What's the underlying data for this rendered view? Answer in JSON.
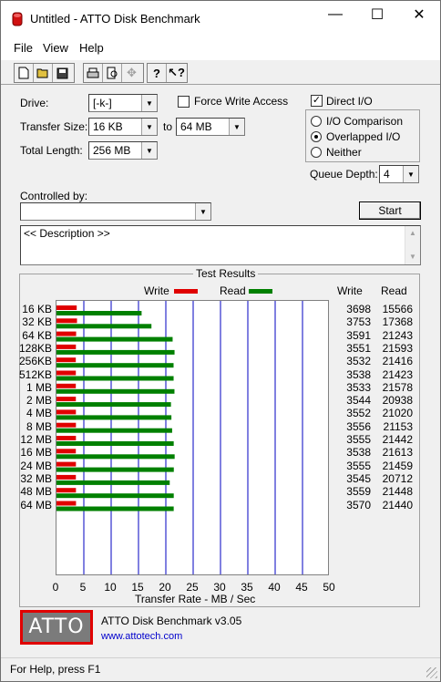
{
  "window": {
    "title": "Untitled - ATTO Disk Benchmark",
    "minimize_glyph": "—",
    "maximize_glyph": "☐",
    "close_glyph": "✕"
  },
  "menu": {
    "file": "File",
    "view": "View",
    "help": "Help"
  },
  "toolbar": {
    "buttons": [
      "new-icon",
      "open-icon",
      "save-icon",
      "print-icon",
      "print-preview-icon",
      "move-icon",
      "help-icon",
      "context-help-icon"
    ]
  },
  "settings": {
    "drive_label": "Drive:",
    "drive_value": "[-k-]",
    "force_write_label": "Force Write Access",
    "force_write_checked": false,
    "direct_io_label": "Direct I/O",
    "direct_io_checked": true,
    "transfer_size_label": "Transfer Size:",
    "transfer_from": "16 KB",
    "transfer_to_label": "to",
    "transfer_to": "64 MB",
    "total_length_label": "Total Length:",
    "total_length": "256 MB",
    "io_options": [
      "I/O Comparison",
      "Overlapped I/O",
      "Neither"
    ],
    "io_selected": "Overlapped I/O",
    "queue_depth_label": "Queue Depth:",
    "queue_depth": "4",
    "controlled_by_label": "Controlled by:",
    "controlled_by_value": "",
    "start_label": "Start",
    "description": "<< Description >>"
  },
  "results_title": "Test Results",
  "legend": {
    "write": "Write",
    "read": "Read"
  },
  "columns": {
    "write": "Write",
    "read": "Read"
  },
  "colors": {
    "write": "#e00000",
    "read": "#008000",
    "grid": "#0000c0"
  },
  "chart_data": {
    "type": "bar",
    "title": "Test Results",
    "xlabel": "Transfer Rate - MB / Sec",
    "xlim": [
      0,
      50
    ],
    "xticks": [
      "0",
      "5",
      "10",
      "15",
      "20",
      "25",
      "30",
      "35",
      "40",
      "45",
      "50"
    ],
    "categories": [
      "16 KB",
      "32 KB",
      "64 KB",
      "128KB",
      "256KB",
      "512KB",
      "1 MB",
      "2 MB",
      "4 MB",
      "8 MB",
      "12 MB",
      "16 MB",
      "24 MB",
      "32 MB",
      "48 MB",
      "64 MB"
    ],
    "series": [
      {
        "name": "Write",
        "values": [
          3.698,
          3.753,
          3.591,
          3.551,
          3.532,
          3.538,
          3.533,
          3.544,
          3.552,
          3.556,
          3.555,
          3.538,
          3.555,
          3.545,
          3.559,
          3.57
        ]
      },
      {
        "name": "Read",
        "values": [
          15.566,
          17.368,
          21.243,
          21.593,
          21.416,
          21.423,
          21.578,
          20.938,
          21.02,
          21.153,
          21.442,
          21.613,
          21.459,
          20.712,
          21.448,
          21.44
        ]
      }
    ],
    "write_text": [
      "3698",
      "3753",
      "3591",
      "3551",
      "3532",
      "3538",
      "3533",
      "3544",
      "3552",
      "3556",
      "3555",
      "3538",
      "3555",
      "3545",
      "3559",
      "3570"
    ],
    "read_text": [
      "15566",
      "17368",
      "21243",
      "21593",
      "21416",
      "21423",
      "21578",
      "20938",
      "21020",
      "21153",
      "21442",
      "21613",
      "21459",
      "20712",
      "21448",
      "21440"
    ]
  },
  "about": {
    "logo_text": "ATTO",
    "product": "ATTO Disk Benchmark v3.05",
    "link": "www.attotech.com"
  },
  "status": "For Help, press F1"
}
